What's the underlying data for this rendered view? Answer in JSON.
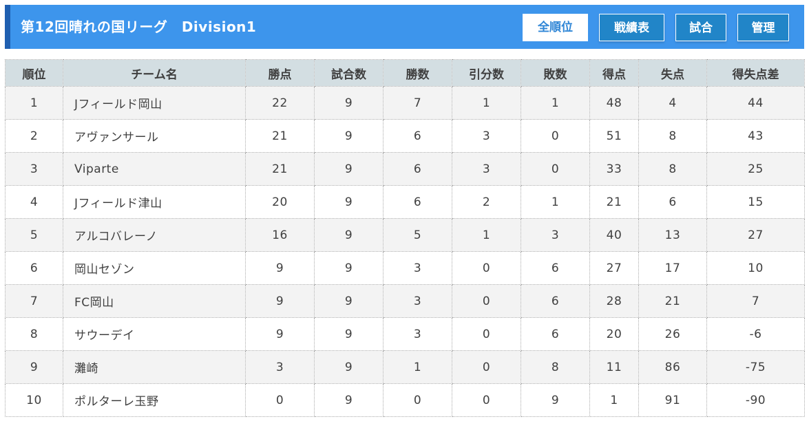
{
  "header": {
    "title": "第12回晴れの国リーグ　Division1",
    "buttons": [
      {
        "label": "全順位",
        "active": true
      },
      {
        "label": "戦績表",
        "active": false
      },
      {
        "label": "試合",
        "active": false
      },
      {
        "label": "管理",
        "active": false
      }
    ]
  },
  "table": {
    "columns": [
      "順位",
      "チーム名",
      "勝点",
      "試合数",
      "勝数",
      "引分数",
      "敗数",
      "得点",
      "失点",
      "得失点差"
    ],
    "rows": [
      [
        "1",
        "Jフィールド岡山",
        "22",
        "9",
        "7",
        "1",
        "1",
        "48",
        "4",
        "44"
      ],
      [
        "2",
        "アヴァンサール",
        "21",
        "9",
        "6",
        "3",
        "0",
        "51",
        "8",
        "43"
      ],
      [
        "3",
        "Viparte",
        "21",
        "9",
        "6",
        "3",
        "0",
        "33",
        "8",
        "25"
      ],
      [
        "4",
        "Jフィールド津山",
        "20",
        "9",
        "6",
        "2",
        "1",
        "21",
        "6",
        "15"
      ],
      [
        "5",
        "アルコバレーノ",
        "16",
        "9",
        "5",
        "1",
        "3",
        "40",
        "13",
        "27"
      ],
      [
        "6",
        "岡山セゾン",
        "9",
        "9",
        "3",
        "0",
        "6",
        "27",
        "17",
        "10"
      ],
      [
        "7",
        "FC岡山",
        "9",
        "9",
        "3",
        "0",
        "6",
        "28",
        "21",
        "7"
      ],
      [
        "8",
        "サウーデイ",
        "9",
        "9",
        "3",
        "0",
        "6",
        "20",
        "26",
        "-6"
      ],
      [
        "9",
        "灘崎",
        "3",
        "9",
        "1",
        "0",
        "8",
        "11",
        "86",
        "-75"
      ],
      [
        "10",
        "ポルターレ玉野",
        "0",
        "9",
        "0",
        "0",
        "9",
        "1",
        "91",
        "-90"
      ]
    ]
  },
  "colors": {
    "header_bg": "#3d95ec",
    "header_accent": "#1f5fb0",
    "button_bg": "#2185c8",
    "table_header_bg": "#d3dee2",
    "row_alt_bg": "#f3f3f3"
  }
}
